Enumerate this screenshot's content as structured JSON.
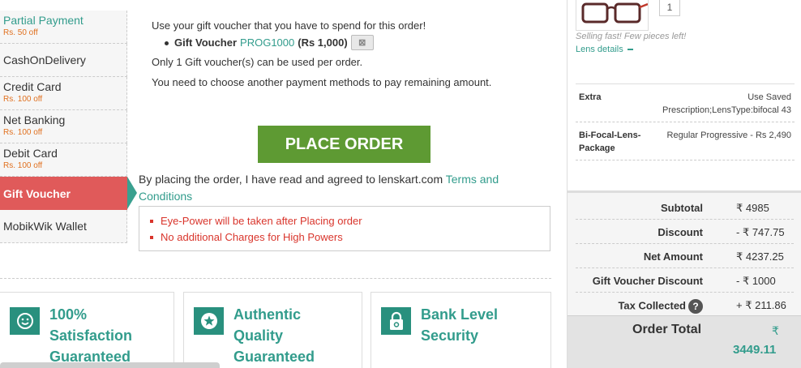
{
  "payment_methods": [
    {
      "label": "Partial Payment",
      "sub": "Rs. 50 off"
    },
    {
      "label": "CashOnDelivery",
      "sub": ""
    },
    {
      "label": "Credit Card",
      "sub": "Rs. 100 off"
    },
    {
      "label": "Net Banking",
      "sub": "Rs. 100 off"
    },
    {
      "label": "Debit Card",
      "sub": "Rs. 100 off"
    },
    {
      "label": "Gift Voucher",
      "sub": "",
      "active": true
    },
    {
      "label": "MobikWik Wallet",
      "sub": ""
    }
  ],
  "gift_voucher": {
    "intro": "Use your gift voucher that you have to spend for this order!",
    "item_label": "Gift Voucher",
    "code": "PROG1000",
    "amount": "(Rs 1,000)",
    "limit_text": "Only 1 Gift voucher(s) can be used per order.",
    "remaining_text": "You need to choose another payment methods to pay remaining amount."
  },
  "place_order_label": "PLACE ORDER",
  "terms": {
    "text": "By placing the order, I have read and agreed to lenskart.com ",
    "link": "Terms and Conditions"
  },
  "notes": [
    "Eye-Power will be taken after Placing order",
    "No additional Charges for High Powers"
  ],
  "features": [
    {
      "text": "100%\nSatisfaction\nGuaranteed",
      "icon": "smiley-icon"
    },
    {
      "text": "Authentic\nQuality\nGuaranteed",
      "icon": "star-badge-icon"
    },
    {
      "text": "Bank Level\nSecurity",
      "icon": "lock-icon"
    }
  ],
  "product": {
    "qty": "1",
    "selling_fast": "Selling fast! Few pieces left!",
    "lens_details": "Lens details"
  },
  "product_rows": [
    {
      "key": "Extra",
      "value": "Use Saved Prescription;LensType:bifocal 43"
    },
    {
      "key": "Bi-Focal-Lens-Package",
      "value": "Regular Progressive - Rs 2,490"
    }
  ],
  "summary": [
    {
      "key": "Subtotal",
      "value": "₹ 4985"
    },
    {
      "key": "Discount",
      "value": "- ₹ 747.75"
    },
    {
      "key": "Net Amount",
      "value": "₹ 4237.25"
    },
    {
      "key": "Gift Voucher Discount",
      "value": "- ₹ 1000"
    },
    {
      "key": "Tax Collected",
      "value": "+ ₹ 211.86"
    }
  ],
  "order_total": {
    "label": "Order Total",
    "symbol": "₹",
    "value": "3449.11"
  },
  "colors": {
    "accent": "#329c8c",
    "active": "#e05a5a",
    "button": "#5e9a33",
    "alert": "#d9352c"
  }
}
